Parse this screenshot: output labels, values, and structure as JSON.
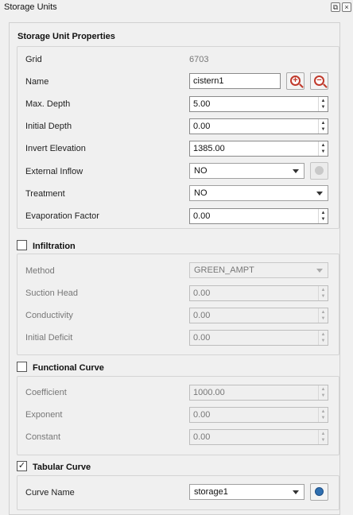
{
  "window": {
    "title": "Storage Units",
    "float_glyph": "⧉",
    "close_glyph": "×"
  },
  "properties": {
    "title": "Storage Unit Properties",
    "grid_label": "Grid",
    "grid_value": "6703",
    "name_label": "Name",
    "name_value": "cistern1",
    "max_depth_label": "Max. Depth",
    "max_depth_value": "5.00",
    "initial_depth_label": "Initial Depth",
    "initial_depth_value": "0.00",
    "invert_label": "Invert Elevation",
    "invert_value": "1385.00",
    "inflow_label": "External Inflow",
    "inflow_value": "NO",
    "treatment_label": "Treatment",
    "treatment_value": "NO",
    "evap_label": "Evaporation Factor",
    "evap_value": "0.00"
  },
  "infiltration": {
    "title": "Infiltration",
    "checked": false,
    "method_label": "Method",
    "method_value": "GREEN_AMPT",
    "suction_label": "Suction Head",
    "suction_value": "0.00",
    "conductivity_label": "Conductivity",
    "conductivity_value": "0.00",
    "deficit_label": "Initial Deficit",
    "deficit_value": "0.00"
  },
  "functional": {
    "title": "Functional Curve",
    "checked": false,
    "coef_label": "Coefficient",
    "coef_value": "1000.00",
    "exponent_label": "Exponent",
    "exponent_value": "0.00",
    "constant_label": "Constant",
    "constant_value": "0.00"
  },
  "tabular": {
    "title": "Tabular Curve",
    "checked": true,
    "check_glyph": "✓",
    "curve_label": "Curve Name",
    "curve_value": "storage1"
  },
  "glyphs": {
    "plus": "+",
    "minus": "−",
    "up": "▲",
    "down": "▼"
  },
  "icons": [
    "zoom-in-icon",
    "zoom-out-icon",
    "circle-icon",
    "chevron-down-icon"
  ],
  "colors": {
    "zoom_icon": "#c0392b",
    "tabular_dot": "#2f6fb0",
    "inflow_dot": "#c9c9c9"
  }
}
